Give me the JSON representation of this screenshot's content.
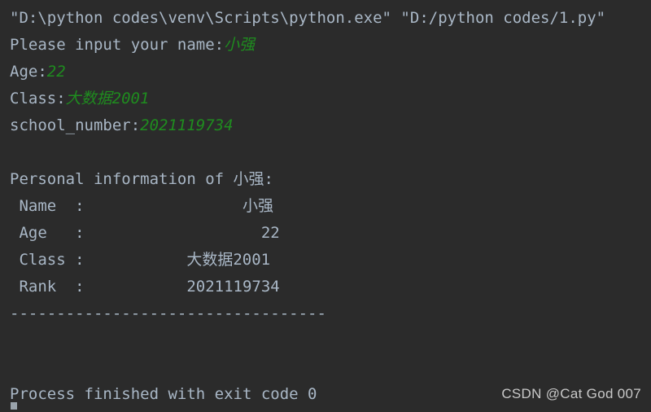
{
  "console": {
    "background_color": "#2b2b2b",
    "text_color": "#a9b7c6",
    "input_value_color": "#1f8c1f",
    "command_line": "\"D:\\python codes\\venv\\Scripts\\python.exe\" \"D:/python codes/1.py\"",
    "prompts": [
      {
        "label": "Please input your name:",
        "value": "小强"
      },
      {
        "label": "Age:",
        "value": "22"
      },
      {
        "label": "Class:",
        "value": "大数据2001"
      },
      {
        "label": "school_number:",
        "value": "2021119734"
      }
    ],
    "report": {
      "heading": "Personal information of 小强:",
      "rows": [
        {
          "label": " Name  :",
          "value": "小强"
        },
        {
          "label": " Age   :",
          "value": "22"
        },
        {
          "label": " Class :",
          "value": "大数据2001"
        },
        {
          "label": " Rank  :",
          "value": "2021119734"
        }
      ],
      "separator": "----------------------------------"
    },
    "exit_message": "Process finished with exit code 0"
  },
  "watermark": {
    "text": "CSDN @Cat God 007"
  }
}
